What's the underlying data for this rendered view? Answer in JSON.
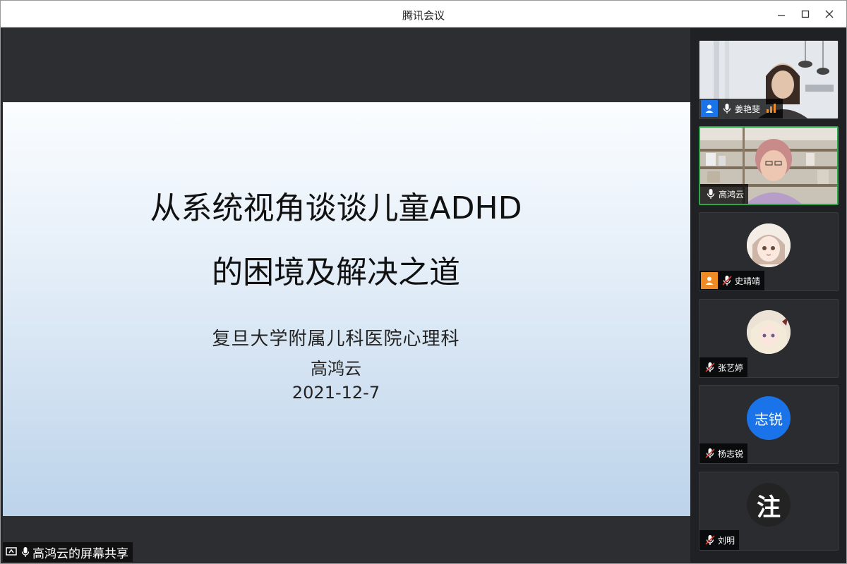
{
  "window": {
    "title": "腾讯会议"
  },
  "slide": {
    "title_line1": "从系统视角谈谈儿童ADHD",
    "title_line2": "的困境及解决之道",
    "affiliation": "复旦大学附属儿科医院心理科",
    "presenter": "高鸿云",
    "date": "2021-12-7"
  },
  "share_badge": {
    "text": "高鸿云的屏幕共享"
  },
  "participants": [
    {
      "name": "姜艳斐",
      "role_icon": "host-user-icon",
      "role_color": "#1a73e8",
      "mic": "on",
      "speaking_icon": "volume-level-icon"
    },
    {
      "name": "高鸿云",
      "mic": "on",
      "active": true
    },
    {
      "name": "史靖靖",
      "role_icon": "cohost-user-icon",
      "role_color": "#f08a24",
      "mic": "muted"
    },
    {
      "name": "张艺婷",
      "mic": "muted"
    },
    {
      "name": "杨志锐",
      "mic": "muted",
      "avatar_text": "志锐",
      "avatar_color": "#1a73e8"
    },
    {
      "name": "刘明",
      "mic": "muted",
      "avatar_text": "注",
      "avatar_color": "#222222"
    }
  ]
}
